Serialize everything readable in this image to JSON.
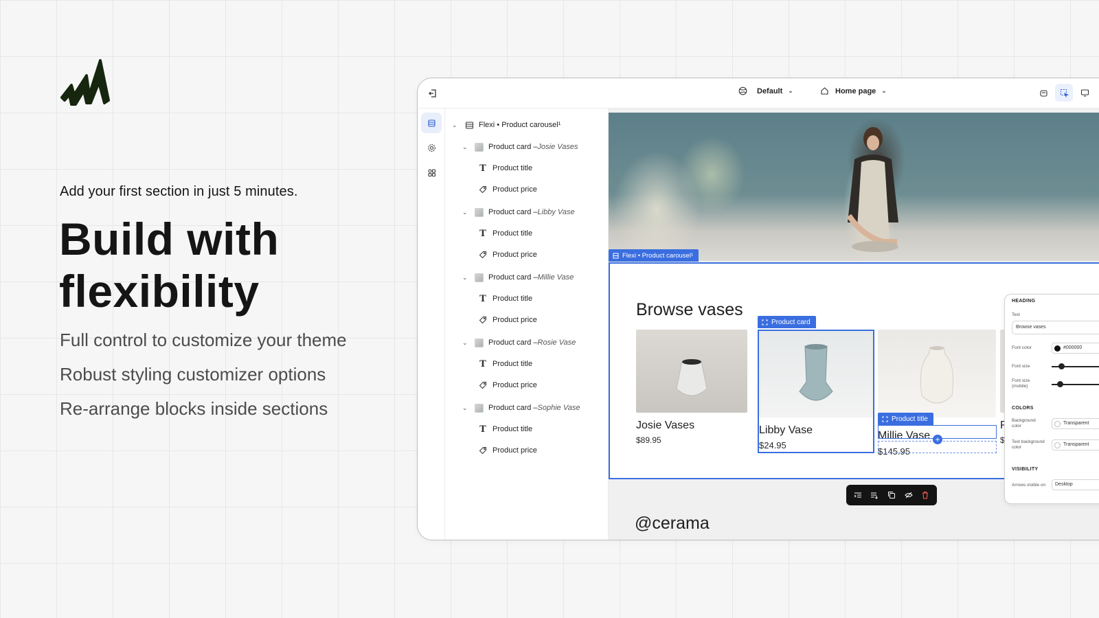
{
  "marketing": {
    "tagline": "Add your first section in just 5 minutes.",
    "headline_line1": "Build with",
    "headline_line2": "flexibility",
    "features": [
      "Full control to customize your theme",
      "Robust styling customizer options",
      "Re-arrange blocks inside sections"
    ]
  },
  "topbar": {
    "theme_dropdown": "Default",
    "page_dropdown": "Home page"
  },
  "tree": {
    "root": "Flexi • Product carousel¹",
    "cards": [
      {
        "label": "Product card – ",
        "name": "Josie Vases"
      },
      {
        "label": "Product card – ",
        "name": "Libby Vase"
      },
      {
        "label": "Product card – ",
        "name": "Millie Vase"
      },
      {
        "label": "Product card – ",
        "name": "Rosie Vase"
      },
      {
        "label": "Product card – ",
        "name": "Sophie Vase"
      }
    ],
    "child_title": "Product title",
    "child_price": "Product price"
  },
  "canvas": {
    "section_tag": "Flexi • Product carousel¹",
    "heading": "Browse vases",
    "product_card_tag": "Product card",
    "product_title_tag": "Product title",
    "products": [
      {
        "name": "Josie Vases",
        "price": "$89.95"
      },
      {
        "name": "Libby Vase",
        "price": "$24.95"
      },
      {
        "name": "Millie Vase",
        "price": "$145.95"
      },
      {
        "name": "R",
        "price": "$"
      }
    ],
    "next_heading": "@cerama"
  },
  "settings": {
    "heading_section": "HEADING",
    "text_label": "Text",
    "text_value": "Browse vases",
    "font_color_label": "Font color",
    "font_color_value": "#000000",
    "font_size_label": "Font size",
    "font_size_mobile_label": "Font size (mobile)",
    "colors_section": "COLORS",
    "bg_color_label": "Background color",
    "bg_color_value": "Transparent",
    "text_bg_label": "Text background color",
    "text_bg_value": "Transparent",
    "visibility_section": "VISIBILITY",
    "arrows_label": "Arrows visible on",
    "arrows_value": "Desktop"
  },
  "colors": {
    "accent": "#3a6ee0",
    "logo": "#16260f"
  }
}
